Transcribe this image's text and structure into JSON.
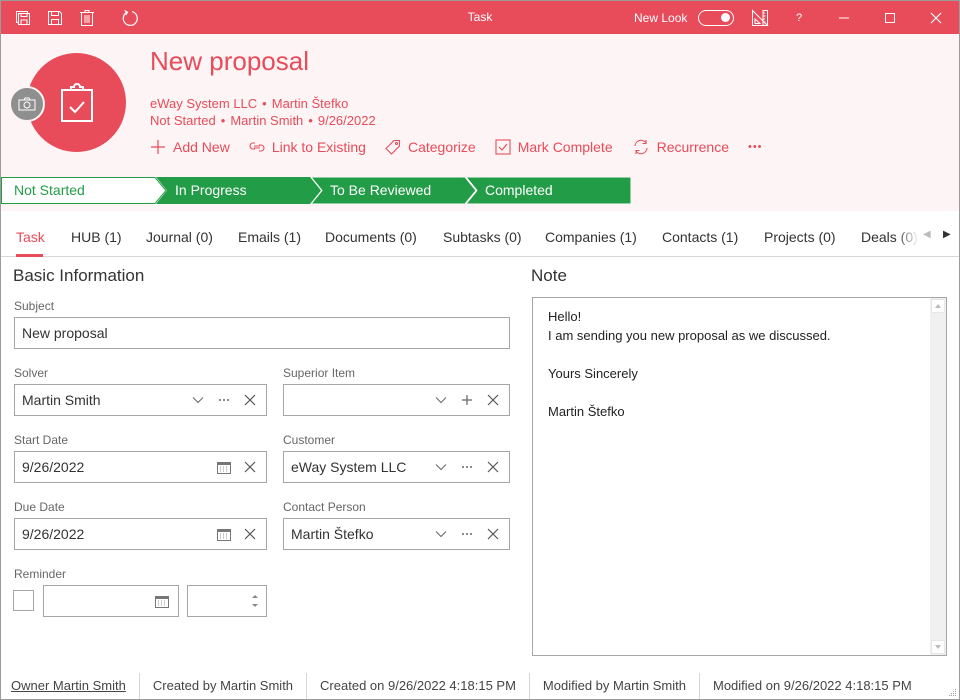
{
  "titlebar": {
    "title": "Task",
    "new_look_label": "New Look",
    "new_look_on": true,
    "help_label": "?",
    "icons": [
      "save-and-close-icon",
      "save-icon",
      "delete-icon",
      "refresh-icon",
      "ruler-triangle-icon",
      "help-icon",
      "minimize-icon",
      "maximize-icon",
      "close-icon"
    ]
  },
  "header": {
    "title": "New proposal",
    "line1": {
      "company": "eWay System LLC",
      "contact": "Martin Štefko"
    },
    "line2": {
      "state": "Not Started",
      "solver": "Martin Smith",
      "date": "9/26/2022"
    },
    "separator": "•",
    "actions": [
      {
        "label": "Add New",
        "icon": "plus-icon"
      },
      {
        "label": "Link to Existing",
        "icon": "link-icon"
      },
      {
        "label": "Categorize",
        "icon": "tag-icon"
      },
      {
        "label": "Mark Complete",
        "icon": "checkbox-icon"
      },
      {
        "label": "Recurrence",
        "icon": "recurrence-icon"
      }
    ],
    "more_label": "•••"
  },
  "stages": [
    {
      "label": "Not Started",
      "current": true
    },
    {
      "label": "In Progress",
      "current": false
    },
    {
      "label": "To Be Reviewed",
      "current": false
    },
    {
      "label": "Completed",
      "current": false
    }
  ],
  "colors": {
    "accent": "#e84b5a",
    "header_bg": "#fdf5f5",
    "stage_green": "#229c47",
    "camera_gray": "#8f8f8f"
  },
  "tabs": [
    {
      "label": "Task",
      "active": true
    },
    {
      "label": "HUB (1)"
    },
    {
      "label": "Journal (0)"
    },
    {
      "label": "Emails (1)"
    },
    {
      "label": "Documents (0)"
    },
    {
      "label": "Subtasks (0)"
    },
    {
      "label": "Companies (1)"
    },
    {
      "label": "Contacts (1)"
    },
    {
      "label": "Projects (0)"
    },
    {
      "label": "Deals (0)"
    }
  ],
  "tab_scroll": {
    "left": "◀",
    "right": "▶"
  },
  "basic": {
    "title": "Basic Information",
    "subject": {
      "label": "Subject",
      "value": "New proposal"
    },
    "solver": {
      "label": "Solver",
      "value": "Martin Smith"
    },
    "superior_item": {
      "label": "Superior Item",
      "value": ""
    },
    "start_date": {
      "label": "Start Date",
      "value": "9/26/2022"
    },
    "customer": {
      "label": "Customer",
      "value": "eWay System LLC"
    },
    "due_date": {
      "label": "Due Date",
      "value": "9/26/2022"
    },
    "contact_person": {
      "label": "Contact Person",
      "value": "Martin Štefko"
    },
    "reminder": {
      "label": "Reminder",
      "checked": false,
      "date": "",
      "time": ""
    }
  },
  "note": {
    "title": "Note",
    "text": "Hello!\nI am sending you new proposal as we discussed.\n\nYours Sincerely\n\nMartin Štefko"
  },
  "footer": {
    "owner": "Owner Martin Smith",
    "created_by": "Created by Martin Smith",
    "created_on": "Created on 9/26/2022 4:18:15 PM",
    "modified_by": "Modified by Martin Smith",
    "modified_on": "Modified on 9/26/2022 4:18:15 PM"
  }
}
